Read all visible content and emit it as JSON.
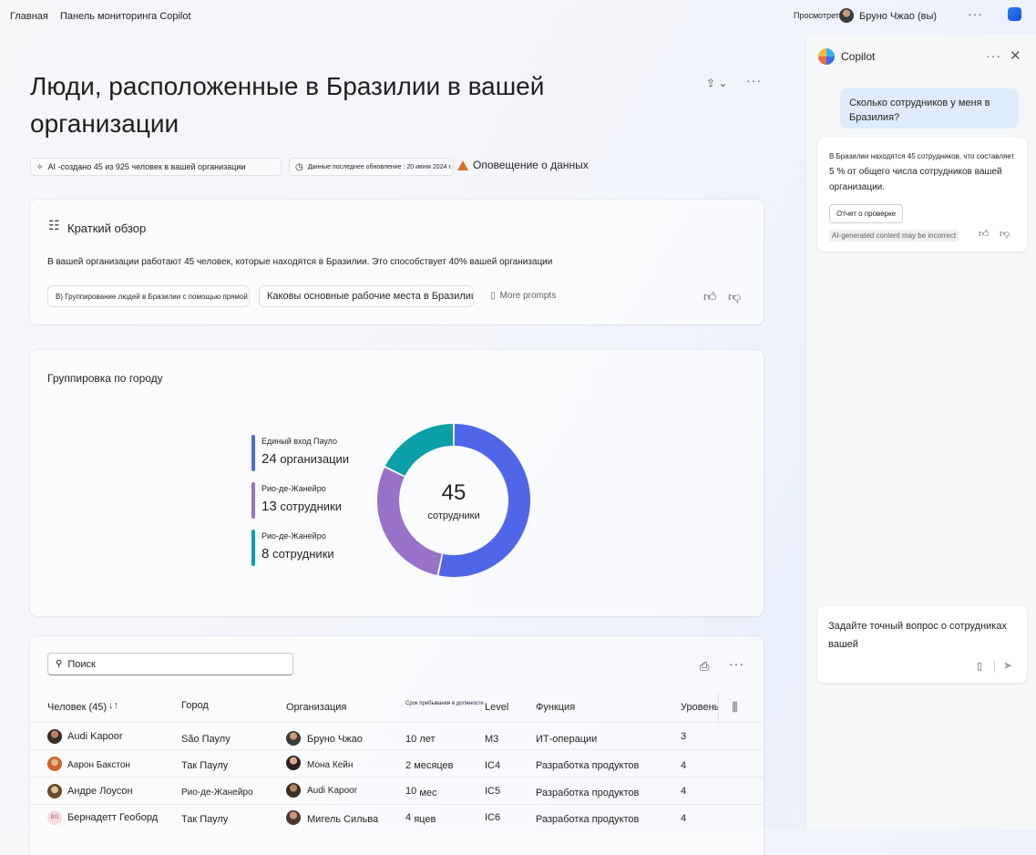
{
  "topbar": {
    "home": "Главная",
    "dashboard": "Панель мониторинга Copilot",
    "view_as": "Просмотреть",
    "user": "Бруно Чжао (вы)"
  },
  "page": {
    "title": "Люди, расположенные в Бразилии в вашей организации",
    "ai_note": "AI -создано 45 из 925 человек в вашей организации",
    "updated": "Данные последнее обновление : 20 июня 2024 г.",
    "alert": "Оповещение о данных"
  },
  "summary": {
    "title": "Краткий обзор",
    "text": "В вашей организации работают 45 человек, которые находятся в Бразилии. Это способствует 40% вашей организации",
    "chips": [
      "B) Группирование людей в Бразилии с помощью прямой команды",
      "Каковы основные рабочие места в Бразилии?"
    ],
    "more_prompts": "More prompts"
  },
  "chart_data": {
    "type": "pie",
    "title": "Группировка по городу",
    "total": "45",
    "total_label": "сотрудники",
    "legend": [
      {
        "name": "Единый вход Пауло",
        "value": 24,
        "unit": "организации",
        "color": "#5066e8"
      },
      {
        "name": "Рио-де-Жанейро",
        "value": 13,
        "unit": "сотрудники",
        "color": "#9872c9"
      },
      {
        "name": "Рио-де-Жанейро",
        "value": 8,
        "unit": "сотрудники",
        "color": "#0b9fa8"
      }
    ]
  },
  "table": {
    "search_placeholder": "Поиск",
    "headers": {
      "person": "Человек (45)",
      "city": "Город",
      "org": "Организация",
      "tenure": "Срок пребывания в должности",
      "level": "Level",
      "function": "Функция",
      "tier": "Уровень"
    },
    "rows": [
      {
        "name": "Audi Kapoor",
        "city": "São Паулу",
        "manager": "Бруно Чжао",
        "tenure_n": "10",
        "tenure_u": "лет",
        "level": "M3",
        "function": "ИТ-операции",
        "tier": "3"
      },
      {
        "name": "Аарон Бакстон",
        "city": "Так Паулу",
        "manager": "Мона Кейн",
        "tenure_n": "2",
        "tenure_u": "месяцев",
        "level": "IC4",
        "function": "Разработка продуктов",
        "tier": "4"
      },
      {
        "name": "Андре Лоусон",
        "city": "Рио-де-Жанейро",
        "manager": "Audi Kapoor",
        "tenure_n": "10",
        "tenure_u": "мес",
        "level": "IC5",
        "function": "Разработка продуктов",
        "tier": "4"
      },
      {
        "name": "Бернадетт Геоборд",
        "initials": "BG",
        "city": "Так Паулу",
        "manager": "Мигель Сильва",
        "tenure_n": "4",
        "tenure_u": "яцев",
        "level": "IC6",
        "function": "Разработка продуктов",
        "tier": "4"
      }
    ]
  },
  "copilot": {
    "title": "Copilot",
    "question": "Сколько сотрудников у меня в Бразилия?",
    "answer_line1": "В Бразилии находятся 45 сотрудников, что составляет",
    "answer_line2": "5 % от общего числа сотрудников вашей организации.",
    "check_button": "Отчет о проверке",
    "ai_badge": "AI-generated content may be incorrect",
    "composer": "Задайте точный вопрос о сотрудниках вашей"
  }
}
